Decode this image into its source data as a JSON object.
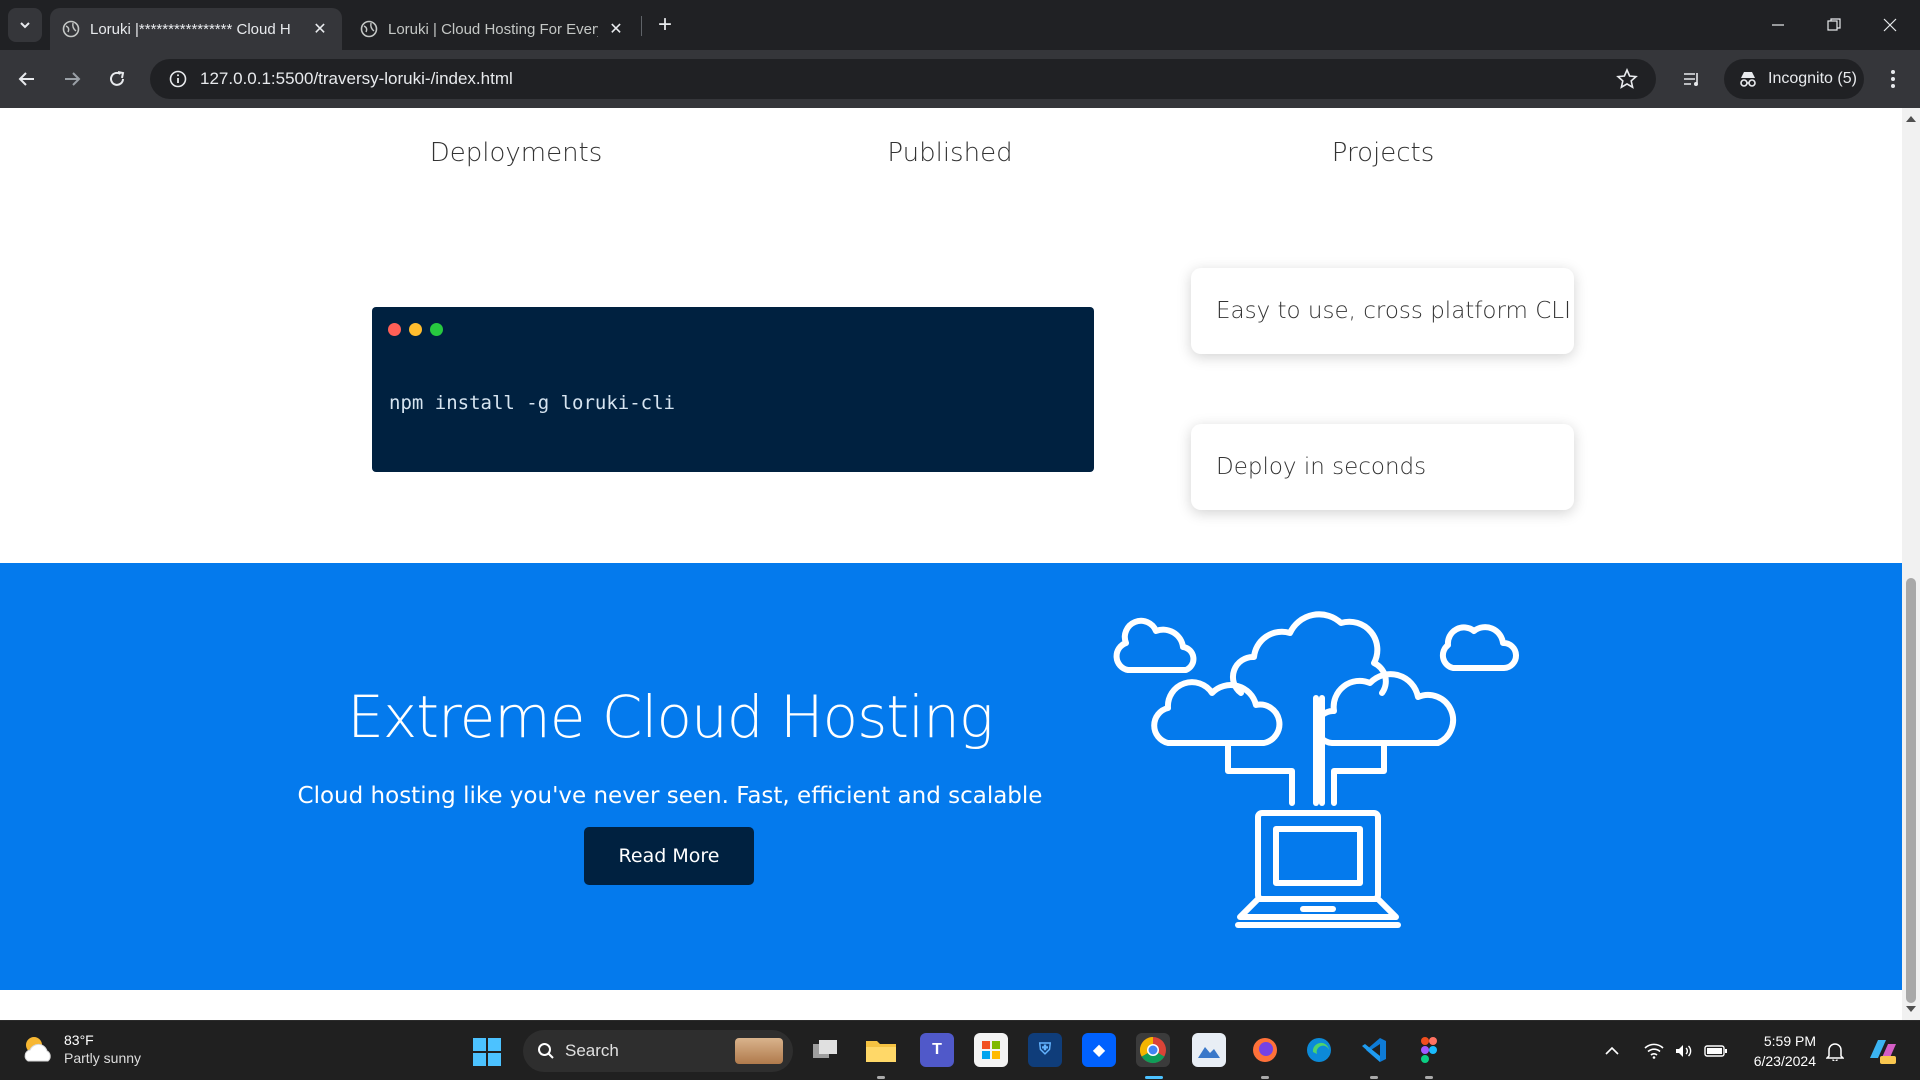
{
  "browser": {
    "tabs": [
      {
        "title": "Loruki |**************** Cloud H",
        "active": true
      },
      {
        "title": "Loruki | Cloud Hosting For Every",
        "active": false
      }
    ],
    "url": "127.0.0.1:5500/traversy-loruki-/index.html",
    "profile_label": "Incognito (5)"
  },
  "page": {
    "stats": [
      "Deployments",
      "Published",
      "Projects"
    ],
    "code_command": "npm install -g loruki-cli",
    "features": [
      "Easy to use, cross platform CLI",
      "Deploy in seconds"
    ],
    "showcase": {
      "title": "Extreme Cloud Hosting",
      "subtitle": "Cloud hosting like you've never seen. Fast, efficient and scalable",
      "button": "Read More"
    },
    "colors": {
      "primary": "#047aed",
      "dark": "#002140"
    }
  },
  "taskbar": {
    "weather": {
      "temp": "83°F",
      "condition": "Partly sunny"
    },
    "search_placeholder": "Search",
    "time": "5:59 PM",
    "date": "6/23/2024"
  }
}
